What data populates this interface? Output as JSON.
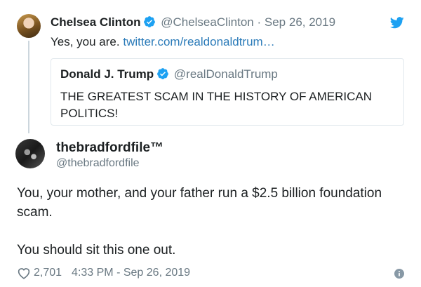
{
  "reply": {
    "name": "Chelsea Clinton",
    "handle": "@ChelseaClinton",
    "separator": "·",
    "date": "Sep 26, 2019",
    "text": "Yes, you are.",
    "link": "twitter.com/realdonaldtrum…"
  },
  "quoted": {
    "name": "Donald J. Trump",
    "handle": "@realDonaldTrump",
    "text": "THE GREATEST SCAM IN THE HISTORY OF AMERICAN POLITICS!"
  },
  "main": {
    "name": "thebradfordfile™",
    "handle": "@thebradfordfile",
    "paragraphs": [
      "You, your mother, and your father run a $2.5 billion foundation scam.",
      "You should sit this one out."
    ]
  },
  "footer": {
    "likes": "2,701",
    "timestamp": "4:33 PM - Sep 26, 2019"
  },
  "icons": {
    "verified": "verified-badge-icon",
    "brand": "twitter-bird-icon",
    "like": "heart-icon",
    "info": "info-icon"
  },
  "colors": {
    "link": "#2b7bb9",
    "verified": "#1da1f2",
    "muted": "#697882",
    "border": "#e1e8ed"
  }
}
